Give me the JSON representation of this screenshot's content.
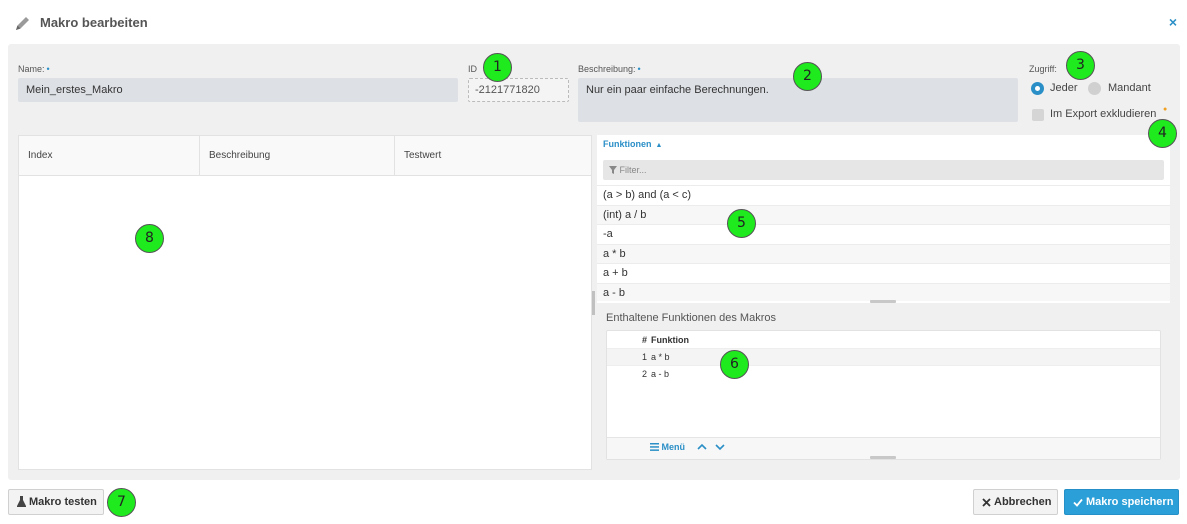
{
  "dialog": {
    "title": "Makro bearbeiten",
    "close_label": "×"
  },
  "form": {
    "name_label": "Name:",
    "name_value": "Mein_erstes_Makro",
    "id_label": "ID",
    "id_value": "-2121771820",
    "description_label": "Beschreibung:",
    "description_value": "Nur ein paar einfache Berechnungen.",
    "required_marker": "•",
    "access_label": "Zugriff:",
    "access_options": [
      "Jeder",
      "Mandant"
    ],
    "access_selected": "Jeder",
    "export_exclude_label": "Im Export exkludieren",
    "export_exclude_checked": false
  },
  "params_table": {
    "columns": [
      "Index",
      "Beschreibung",
      "Testwert"
    ],
    "rows": []
  },
  "functions": {
    "header_label": "Funktionen",
    "filter_placeholder": "Filter...",
    "items": [
      "(a > b) and (a < c)",
      "(int) a / b",
      "-a",
      "a * b",
      "a + b",
      "a - b"
    ]
  },
  "contained": {
    "title": "Enthaltene Funktionen des Makros",
    "columns": [
      "#",
      "Funktion"
    ],
    "rows": [
      {
        "num": "1",
        "func": "a * b"
      },
      {
        "num": "2",
        "func": "a - b"
      }
    ],
    "menu_label": "Menü"
  },
  "buttons": {
    "test_label": "Makro testen",
    "cancel_label": "Abbrechen",
    "save_label": "Makro speichern"
  },
  "annotations": [
    "1",
    "2",
    "3",
    "4",
    "5",
    "6",
    "7",
    "8"
  ],
  "colors": {
    "accent": "#2b8fc7",
    "save_button": "#2b9fd8",
    "badge": "#1eea1e",
    "panel_bg": "#f0f0f0"
  },
  "icons": [
    "pencil-icon",
    "close-icon",
    "filter-icon",
    "menu-icon",
    "arrow-up-icon",
    "arrow-down-icon",
    "flask-icon",
    "x-icon",
    "check-icon",
    "info-icon"
  ]
}
